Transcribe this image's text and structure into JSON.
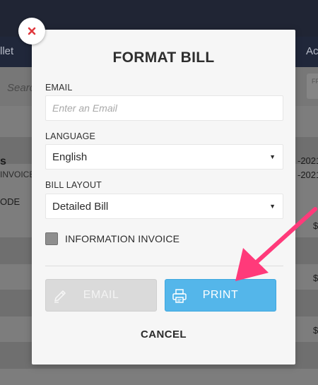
{
  "background": {
    "nav_left": "llet",
    "nav_right": "Act",
    "search_placeholder": "Searc",
    "filter_label": "FF",
    "customer_name": "s",
    "invoice_label": "INVOICE",
    "date_1": "-2021",
    "date_2": "-2021",
    "column_header": "ODE",
    "row_amounts": [
      "$",
      "$",
      "$"
    ]
  },
  "modal": {
    "title": "FORMAT BILL",
    "email_label": "EMAIL",
    "email_placeholder": "Enter an Email",
    "email_value": "",
    "language_label": "LANGUAGE",
    "language_value": "English",
    "layout_label": "BILL LAYOUT",
    "layout_value": "Detailed Bill",
    "information_invoice_label": "INFORMATION INVOICE",
    "information_invoice_checked": false,
    "email_button": "EMAIL",
    "print_button": "PRINT",
    "cancel": "CANCEL"
  },
  "colors": {
    "print_button": "#54b6ea",
    "email_button_disabled": "#dadada",
    "close_icon": "#e0393e",
    "annotation_arrow": "#ff3a7a"
  }
}
